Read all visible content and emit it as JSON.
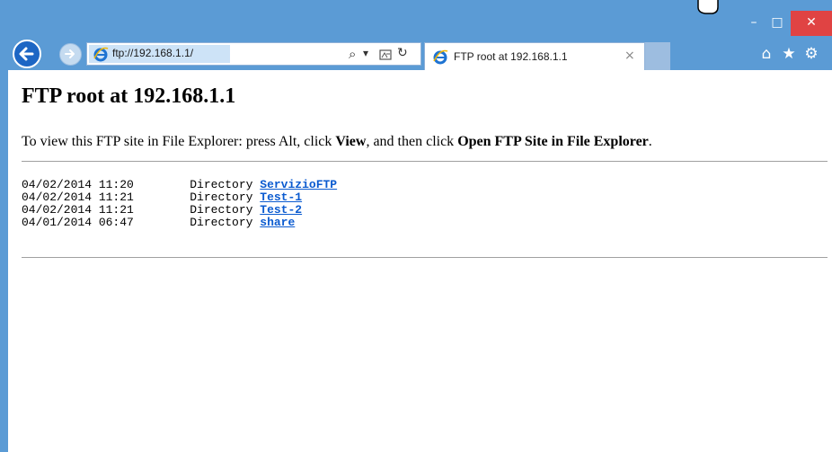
{
  "window": {
    "minimize": "–",
    "maximize": "□",
    "close": "✕"
  },
  "browser": {
    "address": "ftp://192.168.1.1/",
    "tab_title": "FTP root at 192.168.1.1",
    "tab_close": "×",
    "search_icon": "⌕",
    "dropdown_icon": "▾",
    "refresh_icon": "↻",
    "home_icon": "⌂",
    "favorites_icon": "★",
    "tools_icon": "⚙"
  },
  "page": {
    "heading": "FTP root at 192.168.1.1",
    "instr_prefix": "To view this FTP site in File Explorer: press Alt, click ",
    "instr_view": "View",
    "instr_mid": ", and then click ",
    "instr_open": "Open FTP Site in File Explorer",
    "instr_end": ".",
    "listing": [
      {
        "date": "04/02/2014 11:20",
        "type": "Directory",
        "name": "ServizioFTP"
      },
      {
        "date": "04/02/2014 11:21",
        "type": "Directory",
        "name": "Test-1"
      },
      {
        "date": "04/02/2014 11:21",
        "type": "Directory",
        "name": "Test-2"
      },
      {
        "date": "04/01/2014 06:47",
        "type": "Directory",
        "name": "share"
      }
    ]
  },
  "colors": {
    "frame": "#5b9bd5",
    "close": "#e04343",
    "link": "#0b5bd0"
  }
}
